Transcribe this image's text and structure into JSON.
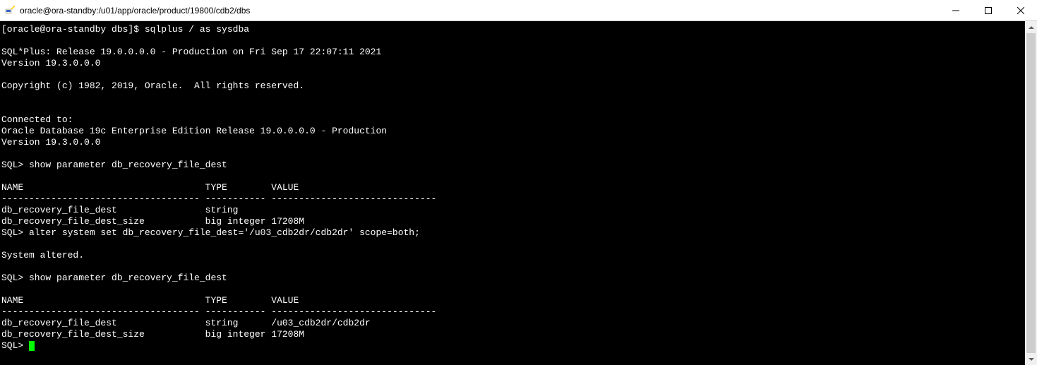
{
  "window": {
    "title": "oracle@ora-standby:/u01/app/oracle/product/19800/cdb2/dbs"
  },
  "terminal": {
    "lines": [
      "[oracle@ora-standby dbs]$ sqlplus / as sysdba",
      "",
      "SQL*Plus: Release 19.0.0.0.0 - Production on Fri Sep 17 22:07:11 2021",
      "Version 19.3.0.0.0",
      "",
      "Copyright (c) 1982, 2019, Oracle.  All rights reserved.",
      "",
      "",
      "Connected to:",
      "Oracle Database 19c Enterprise Edition Release 19.0.0.0.0 - Production",
      "Version 19.3.0.0.0",
      "",
      "SQL> show parameter db_recovery_file_dest",
      "",
      "NAME                                 TYPE        VALUE",
      "------------------------------------ ----------- ------------------------------",
      "db_recovery_file_dest                string",
      "db_recovery_file_dest_size           big integer 17208M",
      "SQL> alter system set db_recovery_file_dest='/u03_cdb2dr/cdb2dr' scope=both;",
      "",
      "System altered.",
      "",
      "SQL> show parameter db_recovery_file_dest",
      "",
      "NAME                                 TYPE        VALUE",
      "------------------------------------ ----------- ------------------------------",
      "db_recovery_file_dest                string      /u03_cdb2dr/cdb2dr",
      "db_recovery_file_dest_size           big integer 17208M"
    ],
    "prompt": "SQL> "
  }
}
